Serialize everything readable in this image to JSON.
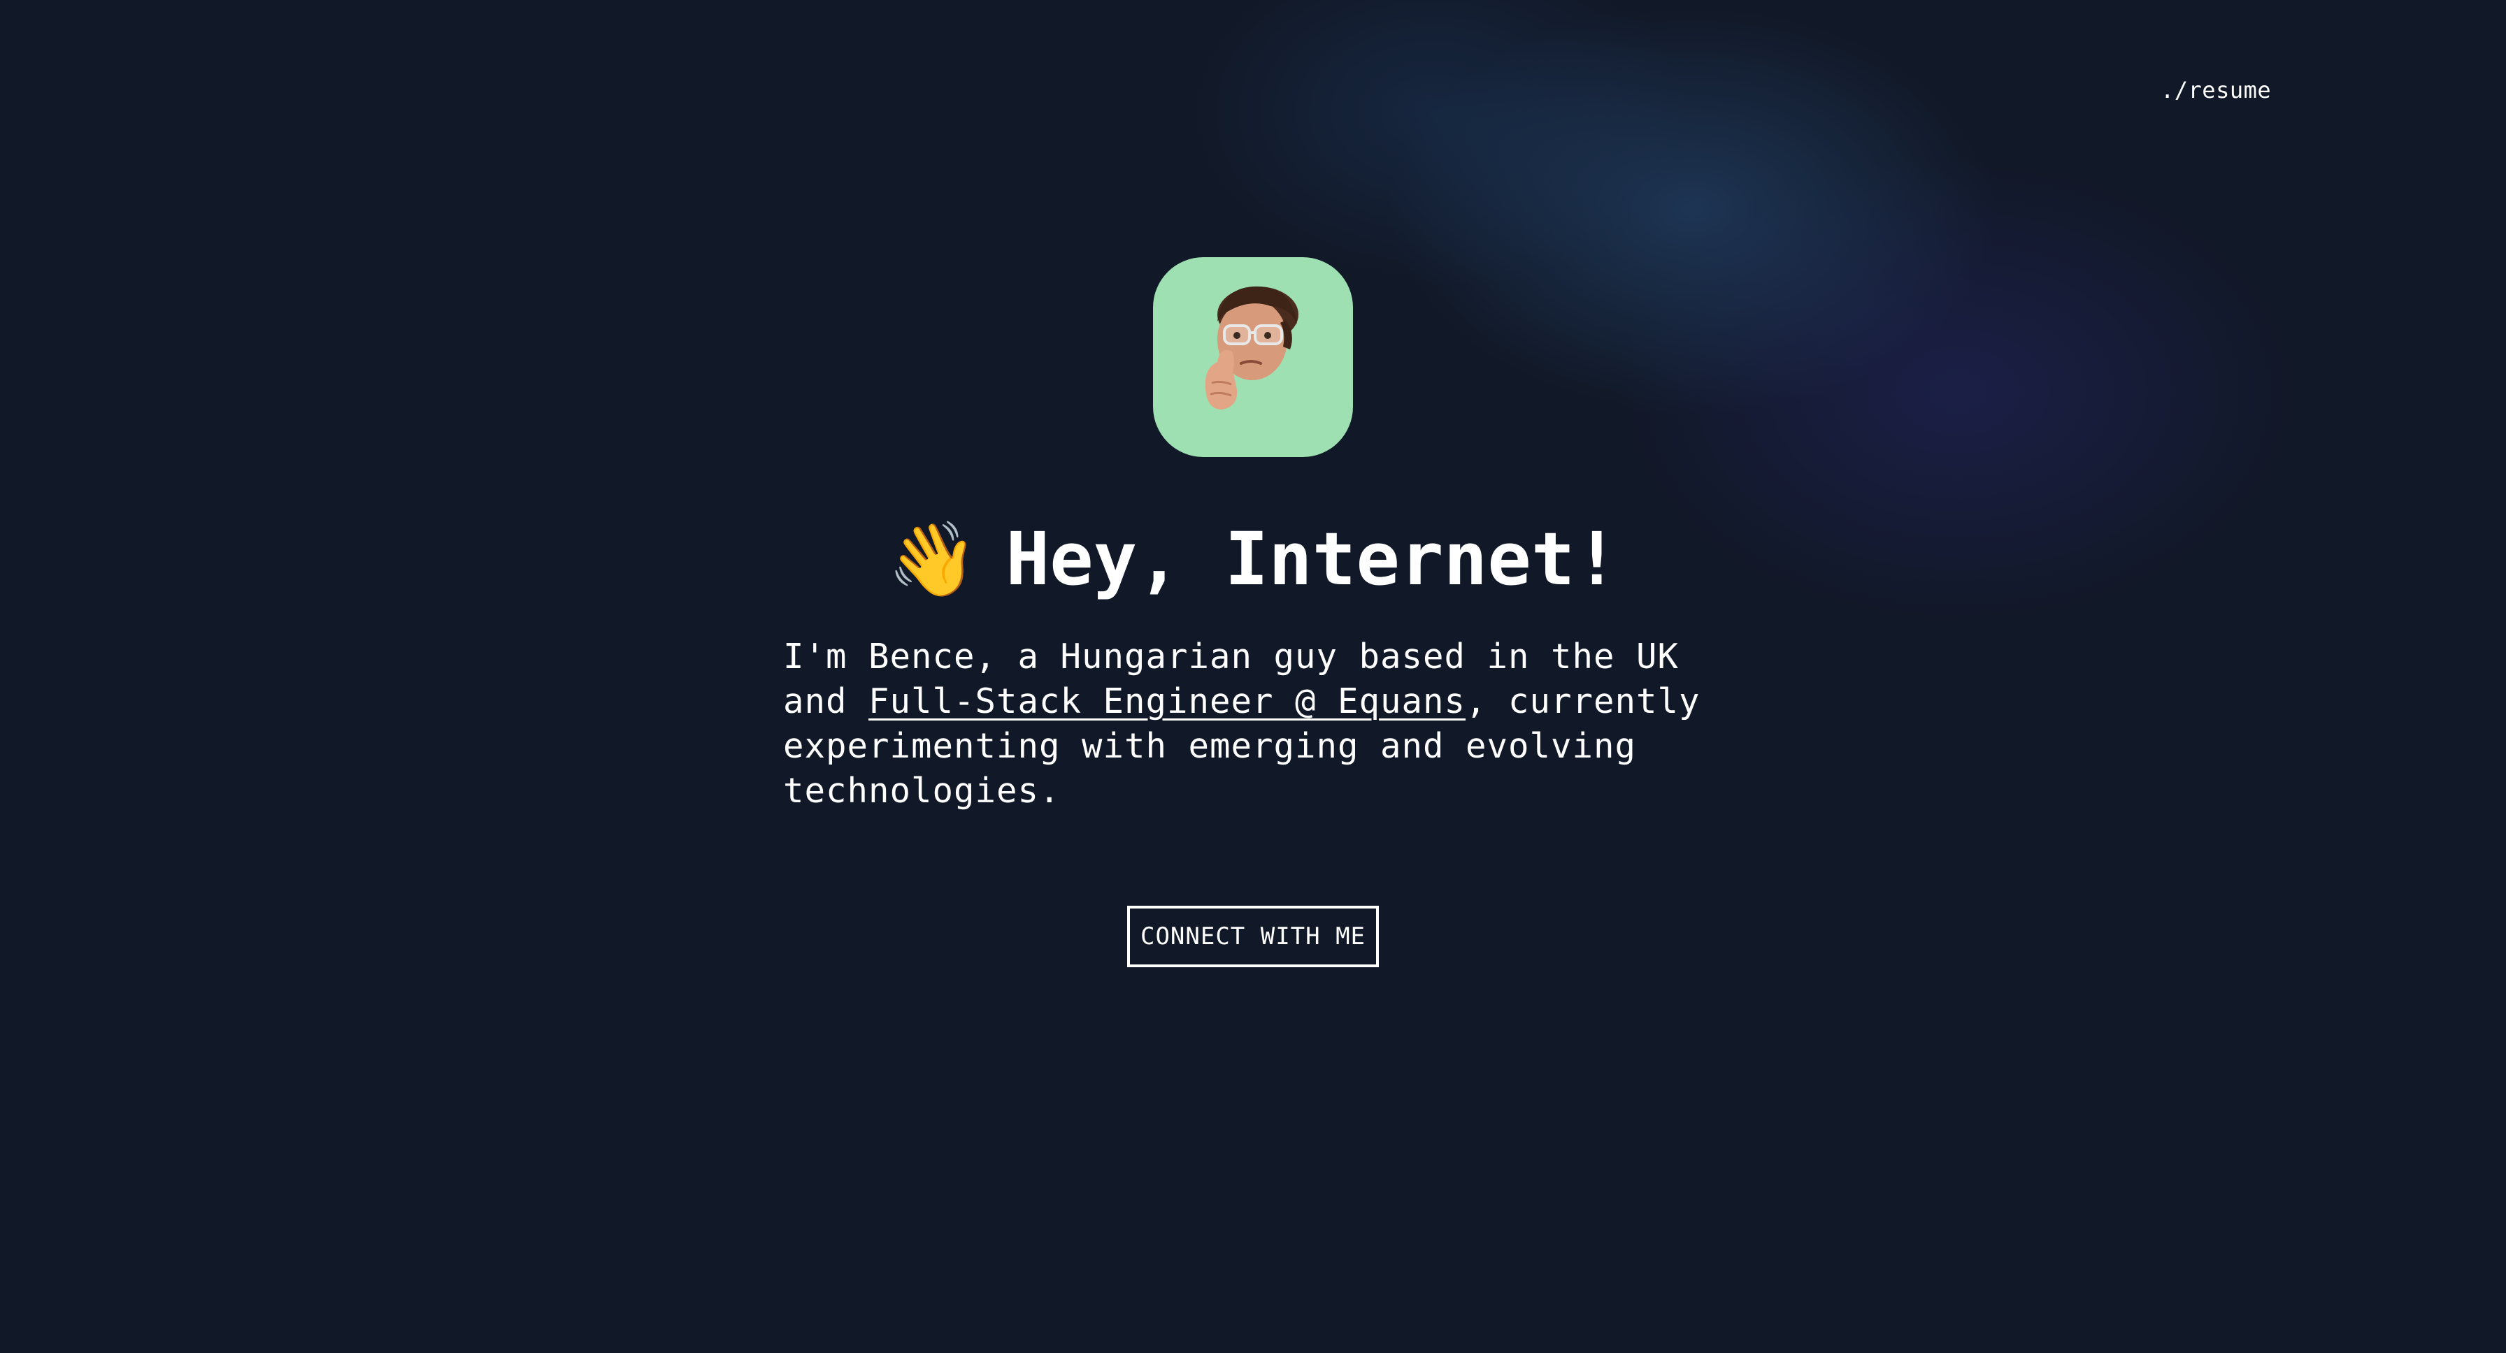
{
  "nav": {
    "resume_label": "./resume"
  },
  "avatar": {
    "background_color": "#9ee0b2",
    "icon": "memoji-thinking-face"
  },
  "hero": {
    "wave_emoji": "👋",
    "title": "Hey, Internet!",
    "bio_prefix": "I'm Bence, a Hungarian guy based in the UK and ",
    "bio_link": "Full-Stack Engineer @ Equans",
    "bio_suffix": ", currently experimenting with emerging and evolving technologies."
  },
  "cta": {
    "label": "CONNECT WITH ME"
  },
  "colors": {
    "background": "#111827",
    "text": "#ffffff",
    "accent_glow": "#274c78"
  }
}
